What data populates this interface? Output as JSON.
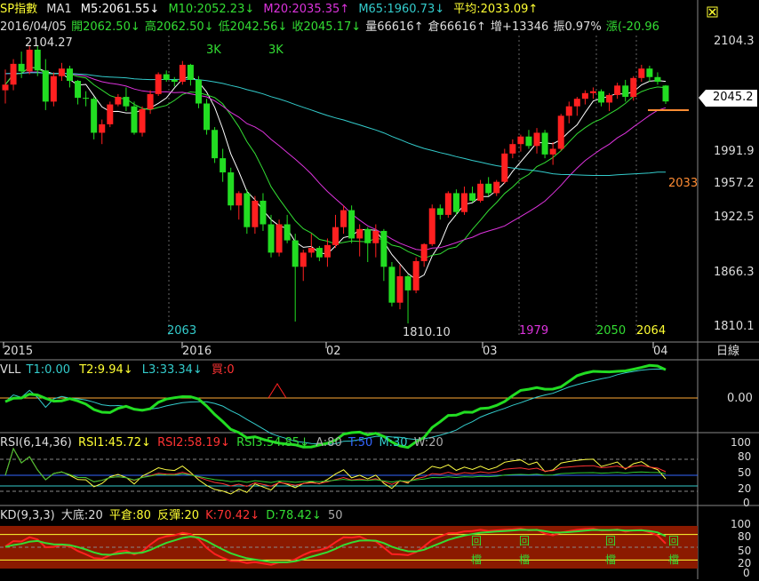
{
  "header": {
    "symbol": "SP指數",
    "ma_title": "MA1",
    "ma5": "M5:2061.55↓",
    "ma10": "M10:2052.23↓",
    "ma20": "M20:2035.35↑",
    "ma65": "M65:1960.73↓",
    "avg": "平均:2033.09↑",
    "date": "2016/04/05",
    "open": "開2062.50↓",
    "high": "高2062.50↓",
    "low": "低2042.56↓",
    "close": "收2045.17↓",
    "volume": "量66616↑",
    "oi": "倉66616↑",
    "inc": "增+13346",
    "amp": "振0.97%",
    "chg": "漲(-20.96"
  },
  "colors": {
    "up": "#ff2020",
    "down": "#22dd22",
    "ma5": "#ffffff",
    "ma10": "#33dd33",
    "ma20": "#dd33dd",
    "ma65": "#33cccc",
    "grid": "#666666",
    "axis_text": "#dddddd",
    "yellow": "#ffff33",
    "rsi1": "#ffff44",
    "rsi2": "#ff3333",
    "rsi3": "#33cc33",
    "kd_bg": "#8b1a00",
    "kd_k": "#ff2020",
    "kd_d": "#33dd33"
  },
  "icons": {
    "close": "close-icon",
    "up_arrow": "up-arrow-icon",
    "down_arrow": "down-arrow-icon"
  },
  "annotations": {
    "peak_label": "2104.27",
    "low_label": "1810.10",
    "k3_a": "3K",
    "k3_b": "3K",
    "day_2063": "2063",
    "day_1979": "1979",
    "day_2050": "2050",
    "day_2064": "2064",
    "ma65_end": "2033",
    "price_tag": "2045.2"
  },
  "x_axis": {
    "labels": [
      "2015",
      "2016",
      "02",
      "03",
      "04"
    ],
    "period": "日線"
  },
  "vll": {
    "title": "VLL",
    "t1": "T1:0.00",
    "t2": "T2:9.94↓",
    "l3": "L3:33.34↓",
    "buy": "買:0",
    "tick": "0.00"
  },
  "rsi": {
    "title": "RSI(6,14,36)",
    "rsi1": "RSI1:45.72↓",
    "rsi2": "RSI2:58.19↓",
    "rsi3": "RSI3:54.85↓",
    "a": "A:80",
    "t": "T:50",
    "m": "M:30",
    "w": "W:20",
    "ticks": [
      "100",
      "80",
      "50",
      "20",
      "0"
    ]
  },
  "kd": {
    "title": "KD(9,3,3)",
    "bottom": "大底:20",
    "flat": "平倉:80",
    "rebound": "反彈:20",
    "k": "K:70.42↓",
    "d": "D:78.42↓",
    "level": "50",
    "ticks": [
      "100",
      "80",
      "50",
      "20",
      "0"
    ],
    "marks": [
      "回",
      "檔",
      "回",
      "檔",
      "回",
      "檔",
      "回",
      "檔"
    ]
  },
  "chart_data": {
    "type": "candlestick",
    "title": "SP指數 日線",
    "x_labels": [
      "2015",
      "2016",
      "02",
      "03",
      "04"
    ],
    "ylim": [
      1795,
      2115
    ],
    "y_ticks": [
      2104.3,
      1991.9,
      1957.2,
      1922.5,
      1866.3,
      1810.1
    ],
    "candles": [
      [
        2057,
        2079,
        2043,
        2063
      ],
      [
        2063,
        2090,
        2057,
        2085
      ],
      [
        2085,
        2098,
        2070,
        2077
      ],
      [
        2077,
        2104,
        2074,
        2100
      ],
      [
        2100,
        2104,
        2072,
        2078
      ],
      [
        2078,
        2090,
        2036,
        2045
      ],
      [
        2045,
        2076,
        2040,
        2072
      ],
      [
        2072,
        2086,
        2067,
        2080
      ],
      [
        2080,
        2083,
        2060,
        2067
      ],
      [
        2067,
        2068,
        2042,
        2049
      ],
      [
        2049,
        2056,
        2040,
        2048
      ],
      [
        2048,
        2050,
        2005,
        2012
      ],
      [
        2012,
        2026,
        2000,
        2021
      ],
      [
        2021,
        2045,
        2018,
        2042
      ],
      [
        2042,
        2053,
        2040,
        2050
      ],
      [
        2050,
        2060,
        2035,
        2040
      ],
      [
        2040,
        2045,
        2010,
        2012
      ],
      [
        2012,
        2040,
        2008,
        2037
      ],
      [
        2037,
        2057,
        2032,
        2053
      ],
      [
        2053,
        2076,
        2051,
        2074
      ],
      [
        2074,
        2078,
        2066,
        2068
      ],
      [
        2068,
        2071,
        2061,
        2066
      ],
      [
        2066,
        2088,
        2063,
        2084
      ],
      [
        2084,
        2085,
        2062,
        2068
      ],
      [
        2068,
        2072,
        2038,
        2043
      ],
      [
        2043,
        2048,
        2010,
        2015
      ],
      [
        2015,
        2018,
        1980,
        1985
      ],
      [
        1985,
        1995,
        1960,
        1970
      ],
      [
        1970,
        1975,
        1930,
        1935
      ],
      [
        1935,
        1950,
        1920,
        1948
      ],
      [
        1948,
        1952,
        1905,
        1912
      ],
      [
        1912,
        1945,
        1905,
        1940
      ],
      [
        1940,
        1948,
        1908,
        1915
      ],
      [
        1915,
        1925,
        1880,
        1885
      ],
      [
        1885,
        1920,
        1881,
        1915
      ],
      [
        1915,
        1925,
        1895,
        1898
      ],
      [
        1898,
        1905,
        1812,
        1870
      ],
      [
        1870,
        1888,
        1855,
        1885
      ],
      [
        1885,
        1905,
        1880,
        1890
      ],
      [
        1890,
        1892,
        1876,
        1880
      ],
      [
        1880,
        1900,
        1870,
        1893
      ],
      [
        1893,
        1925,
        1890,
        1912
      ],
      [
        1912,
        1935,
        1905,
        1930
      ],
      [
        1930,
        1935,
        1895,
        1900
      ],
      [
        1900,
        1915,
        1881,
        1910
      ],
      [
        1910,
        1912,
        1875,
        1895
      ],
      [
        1895,
        1915,
        1880,
        1908
      ],
      [
        1908,
        1910,
        1855,
        1870
      ],
      [
        1870,
        1875,
        1828,
        1832
      ],
      [
        1832,
        1872,
        1825,
        1860
      ],
      [
        1860,
        1862,
        1810,
        1845
      ],
      [
        1845,
        1880,
        1842,
        1876
      ],
      [
        1876,
        1895,
        1870,
        1894
      ],
      [
        1894,
        1936,
        1892,
        1932
      ],
      [
        1932,
        1936,
        1920,
        1925
      ],
      [
        1925,
        1950,
        1922,
        1948
      ],
      [
        1948,
        1952,
        1925,
        1928
      ],
      [
        1928,
        1955,
        1925,
        1948
      ],
      [
        1948,
        1955,
        1938,
        1940
      ],
      [
        1940,
        1962,
        1938,
        1958
      ],
      [
        1958,
        1965,
        1945,
        1948
      ],
      [
        1948,
        1962,
        1945,
        1960
      ],
      [
        1960,
        1995,
        1958,
        1990
      ],
      [
        1990,
        2005,
        1985,
        2000
      ],
      [
        2000,
        2010,
        1992,
        2008
      ],
      [
        2008,
        2015,
        1995,
        1998
      ],
      [
        1998,
        2017,
        1990,
        2012
      ],
      [
        2012,
        2015,
        1985,
        1989
      ],
      [
        1989,
        2002,
        1978,
        1995
      ],
      [
        1995,
        2032,
        1993,
        2030
      ],
      [
        2030,
        2045,
        2022,
        2040
      ],
      [
        2040,
        2050,
        2030,
        2048
      ],
      [
        2048,
        2057,
        2042,
        2054
      ],
      [
        2054,
        2060,
        2048,
        2056
      ],
      [
        2056,
        2058,
        2040,
        2044
      ],
      [
        2044,
        2054,
        2035,
        2052
      ],
      [
        2052,
        2065,
        2048,
        2062
      ],
      [
        2062,
        2068,
        2045,
        2050
      ],
      [
        2050,
        2072,
        2046,
        2070
      ],
      [
        2070,
        2084,
        2066,
        2080
      ],
      [
        2080,
        2083,
        2066,
        2071
      ],
      [
        2071,
        2076,
        2063,
        2066
      ],
      [
        2062,
        2062.5,
        2042.56,
        2045.17
      ]
    ],
    "rsi_levels": {
      "A": 80,
      "T": 50,
      "M": 30,
      "W": 20
    },
    "kd_levels": {
      "bottom": 20,
      "flat": 80,
      "rebound": 20
    }
  }
}
